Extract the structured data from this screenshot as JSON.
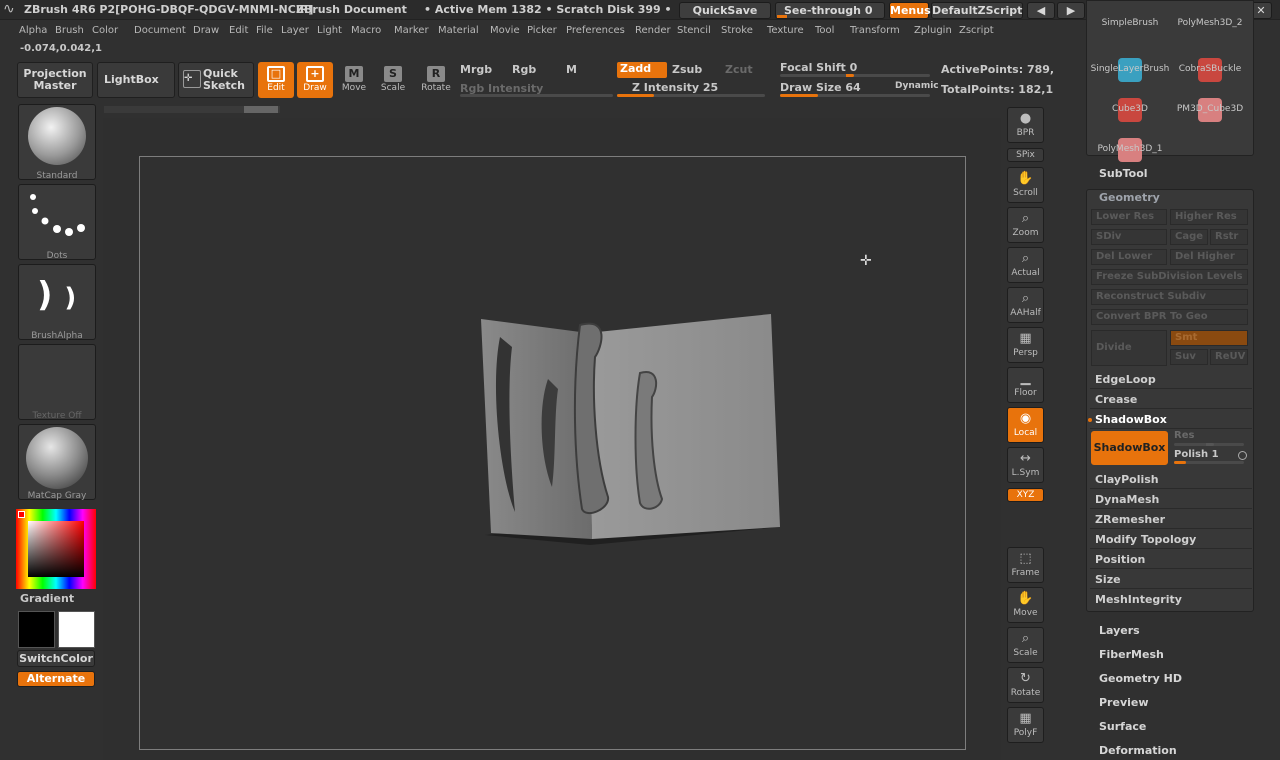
{
  "app": {
    "title": "ZBrush 4R6  P2[POHG-DBQF-QDGV-MNMI-NCIR]",
    "document": "ZBrush Document",
    "active_mem": "• Active Mem 1382 • Scratch Disk 399 •",
    "quicksave": "QuickSave",
    "see_through": "See-through   0",
    "menus": "Menus",
    "script": "DefaultZScript",
    "coords": "-0.074,0.042,1"
  },
  "menu": [
    "Alpha",
    "Brush",
    "Color",
    "Document",
    "Draw",
    "Edit",
    "File",
    "Layer",
    "Light",
    "Macro",
    "Marker",
    "Material",
    "Movie",
    "Picker",
    "Preferences",
    "Render",
    "Stencil",
    "Stroke",
    "Texture",
    "Tool",
    "Transform",
    "Zplugin",
    "Zscript"
  ],
  "toolbar": {
    "projection_master": "Projection Master",
    "lightbox": "LightBox",
    "quick_sketch": "Quick Sketch",
    "edit": "Edit",
    "draw": "Draw",
    "move": "Move",
    "scale": "Scale",
    "rotate": "Rotate",
    "mrgb": "Mrgb",
    "rgb": "Rgb",
    "m": "M",
    "zadd": "Zadd",
    "zsub": "Zsub",
    "zcut": "Zcut",
    "rgb_intensity": "Rgb  Intensity",
    "z_intensity": "Z Intensity 25",
    "focal_shift": "Focal Shift 0",
    "draw_size": "Draw Size 64",
    "dynamic": "Dynamic",
    "active_points": "ActivePoints: 789,",
    "total_points": "TotalPoints: 182,1",
    "z_intensity_value": 25,
    "draw_size_value": 64
  },
  "left": {
    "standard": "Standard",
    "dots": "Dots",
    "brush_alpha": "BrushAlpha",
    "texture_off": "Texture Off",
    "matcap": "MatCap Gray",
    "gradient": "Gradient",
    "switch_color": "SwitchColor",
    "alternate": "Alternate"
  },
  "right_tools": [
    "BPR",
    "SPix",
    "Scroll",
    "Zoom",
    "Actual",
    "AAHalf",
    "Persp",
    "Floor",
    "Local",
    "L.Sym",
    "XYZ",
    "Frame",
    "Move",
    "Scale",
    "Rotate",
    "PolyF"
  ],
  "subtools": {
    "items": [
      "SimpleBrush",
      "PolyMesh3D_2",
      "SingleLayerBrush",
      "CobraSBuckle",
      "Cube3D",
      "PM3D_Cube3D",
      "PolyMesh3D_1"
    ]
  },
  "panel": {
    "subtool": "SubTool",
    "geometry": "Geometry",
    "lower_res": "Lower Res",
    "higher_res": "Higher Res",
    "sdiv": "SDiv",
    "cage": "Cage",
    "rstr": "Rstr",
    "del_lower": "Del Lower",
    "del_higher": "Del Higher",
    "freeze": "Freeze SubDivision Levels",
    "reconstruct": "Reconstruct Subdiv",
    "convert_bpr": "Convert BPR To Geo",
    "divide": "Divide",
    "smt": "Smt",
    "suv": "Suv",
    "reuv": "ReUV",
    "edgeloop": "EdgeLoop",
    "crease": "Crease",
    "shadowbox_header": "ShadowBox",
    "shadowbox_btn": "ShadowBox",
    "res": "Res",
    "polish": "Polish 1",
    "claypolish": "ClayPolish",
    "dynamesh": "DynaMesh",
    "zremesher": "ZRemesher",
    "modify_topology": "Modify Topology",
    "position": "Position",
    "size": "Size",
    "meshintegrity": "MeshIntegrity",
    "layers": "Layers",
    "fibermesh": "FiberMesh",
    "geometry_hd": "Geometry HD",
    "preview": "Preview",
    "surface": "Surface",
    "deformation": "Deformation"
  },
  "colors": {
    "accent": "#e8730c",
    "bg": "#303030"
  }
}
